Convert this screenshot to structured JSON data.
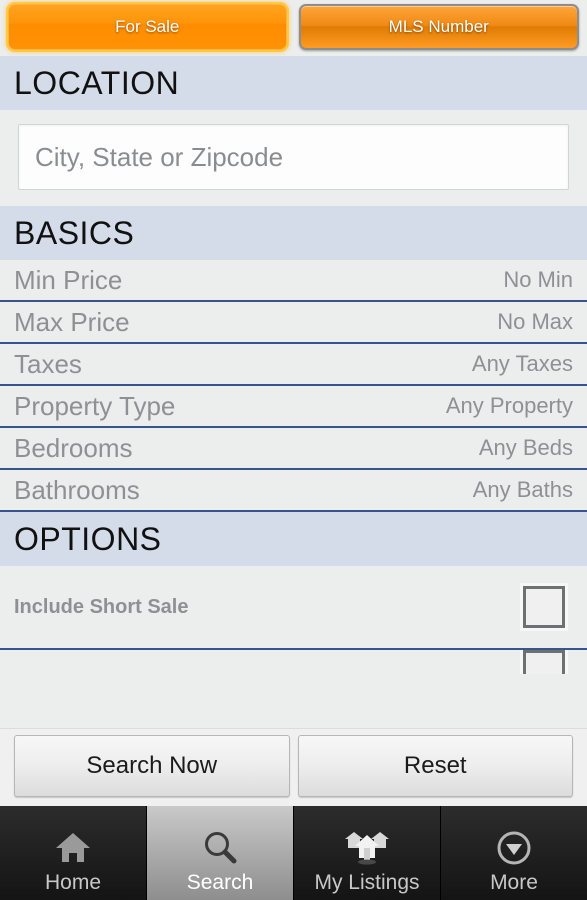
{
  "tabs": [
    {
      "label": "For Sale",
      "state": "selected",
      "name": "tab-for-sale"
    },
    {
      "label": "MLS Number",
      "state": "unselected",
      "name": "tab-mls-number"
    }
  ],
  "sections": {
    "location": {
      "header": "LOCATION",
      "input": {
        "value": "",
        "placeholder": "City, State or Zipcode"
      }
    },
    "basics": {
      "header": "BASICS",
      "rows": [
        {
          "label": "Min Price",
          "value": "No Min"
        },
        {
          "label": "Max Price",
          "value": "No Max"
        },
        {
          "label": "Taxes",
          "value": "Any Taxes"
        },
        {
          "label": "Property Type",
          "value": "Any Property"
        },
        {
          "label": "Bedrooms",
          "value": "Any Beds"
        },
        {
          "label": "Bathrooms",
          "value": "Any Baths"
        }
      ]
    },
    "options": {
      "header": "OPTIONS",
      "rows": [
        {
          "label": "Include Short Sale",
          "checked": false
        },
        {
          "label": "",
          "checked": false
        }
      ]
    }
  },
  "actions": {
    "search": "Search Now",
    "reset": "Reset"
  },
  "nav": {
    "items": [
      {
        "label": "Home",
        "icon": "home-icon",
        "active": false
      },
      {
        "label": "Search",
        "icon": "magnifier-icon",
        "active": true
      },
      {
        "label": "My Listings",
        "icon": "houses-icon",
        "active": false
      },
      {
        "label": "More",
        "icon": "chevron-down-circle-icon",
        "active": false
      }
    ]
  },
  "colors": {
    "accent_orange": "#ff8c00",
    "section_header_bg": "#d5dce9",
    "row_divider": "#37548c",
    "page_bg": "#eceded"
  }
}
